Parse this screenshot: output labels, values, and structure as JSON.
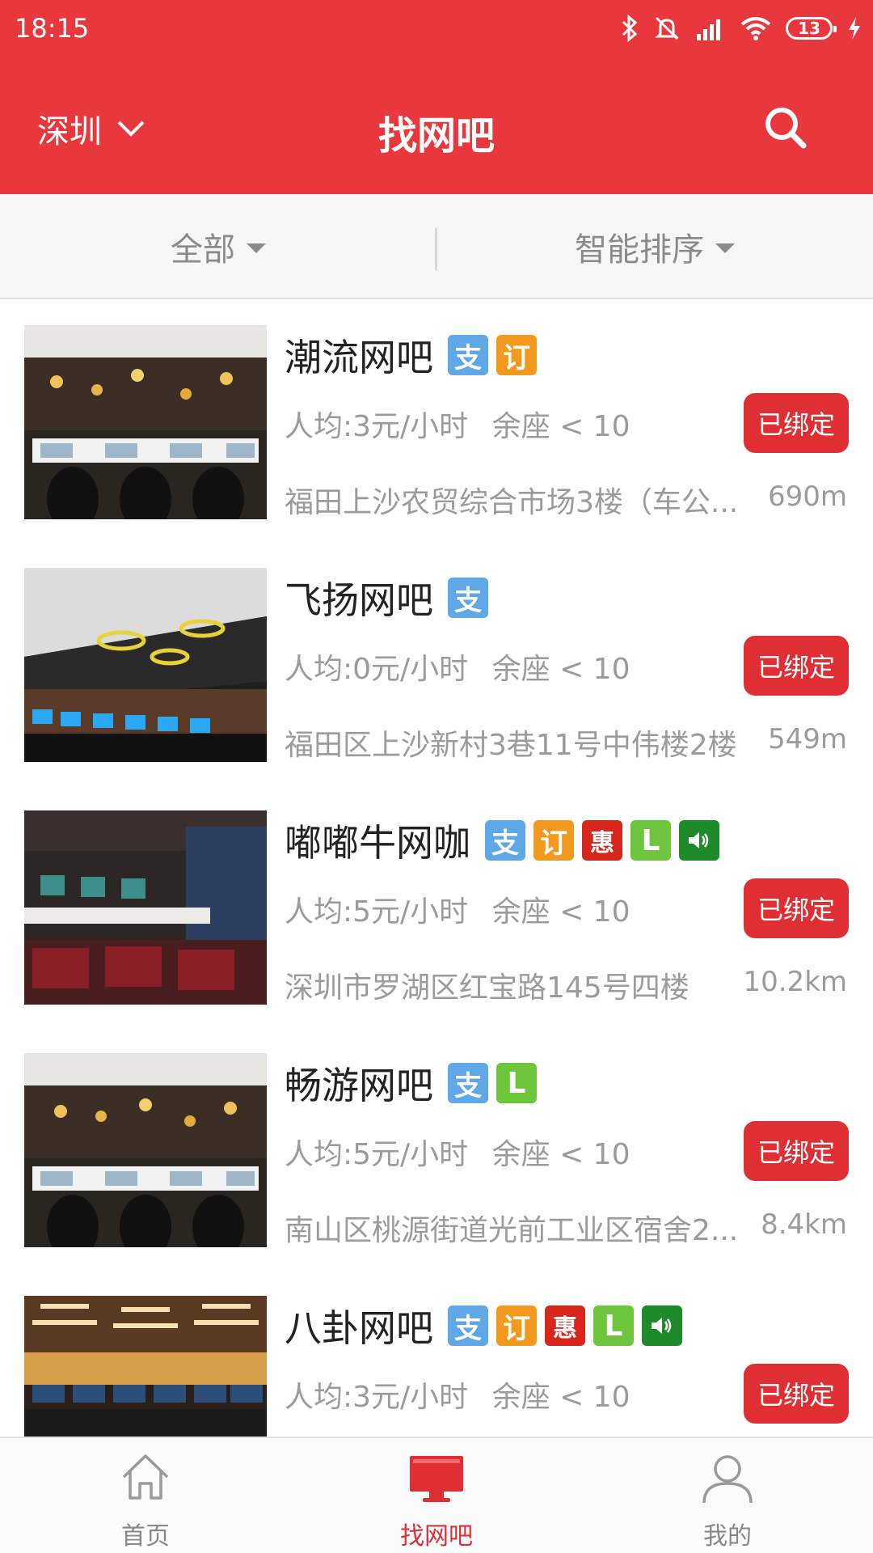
{
  "status": {
    "time": "18:15",
    "battery": "13"
  },
  "header": {
    "city": "深圳",
    "title": "找网吧",
    "search_icon": "search-icon"
  },
  "filters": {
    "category": "全部",
    "sort": "智能排序"
  },
  "colors": {
    "brand": "#e8383d",
    "tag_zhi": "#5fa8e8",
    "tag_ding": "#f39a1e",
    "tag_hui": "#d9261c",
    "tag_l": "#6cc53b",
    "tag_sound": "#1e8a2a"
  },
  "cafes": [
    {
      "name": "潮流网吧",
      "tags": [
        "支",
        "订"
      ],
      "price": "人均:3元/小时",
      "seats": "余座 < 10",
      "status": "已绑定",
      "address": "福田上沙农贸综合市场3楼（车公...",
      "distance": "690m"
    },
    {
      "name": "飞扬网吧",
      "tags": [
        "支"
      ],
      "price": "人均:0元/小时",
      "seats": "余座 < 10",
      "status": "已绑定",
      "address": "福田区上沙新村3巷11号中伟楼2楼",
      "distance": "549m"
    },
    {
      "name": "嘟嘟牛网咖",
      "tags": [
        "支",
        "订",
        "惠",
        "L",
        "sound"
      ],
      "price": "人均:5元/小时",
      "seats": "余座 < 10",
      "status": "已绑定",
      "address": "深圳市罗湖区红宝路145号四楼",
      "distance": "10.2km"
    },
    {
      "name": "畅游网吧",
      "tags": [
        "支",
        "L"
      ],
      "price": "人均:5元/小时",
      "seats": "余座 < 10",
      "status": "已绑定",
      "address": "南山区桃源街道光前工业区宿舍2...",
      "distance": "8.4km"
    },
    {
      "name": "八卦网吧",
      "tags": [
        "支",
        "订",
        "惠",
        "L",
        "sound"
      ],
      "price": "人均:3元/小时",
      "seats": "余座 < 10",
      "status": "已绑定"
    }
  ],
  "bottom_nav": [
    {
      "label": "首页",
      "icon": "home-icon"
    },
    {
      "label": "找网吧",
      "icon": "monitor-icon",
      "active": true
    },
    {
      "label": "我的",
      "icon": "user-icon"
    }
  ]
}
